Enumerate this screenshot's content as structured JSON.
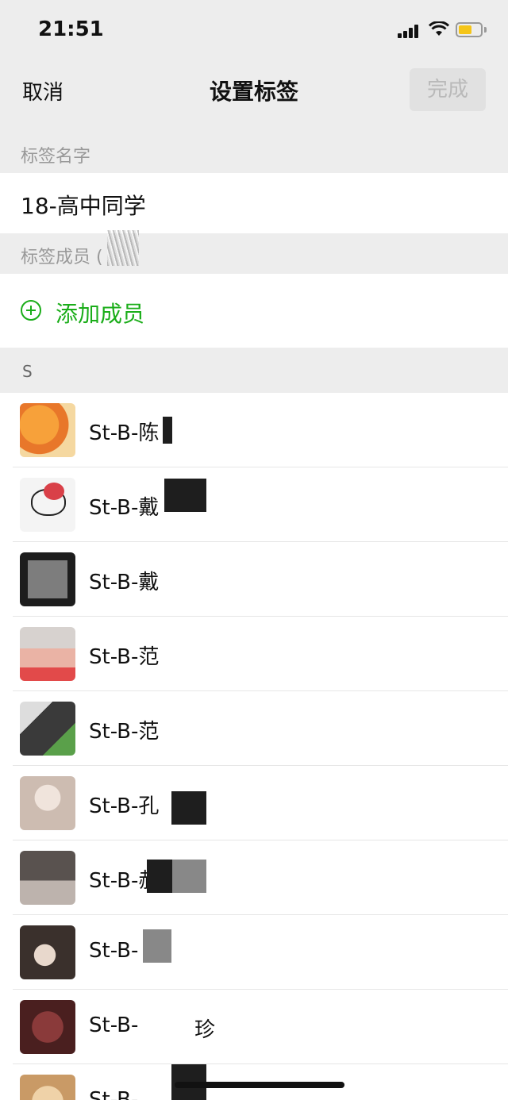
{
  "status": {
    "time": "21:51",
    "battery_level": 0.6
  },
  "nav": {
    "cancel_label": "取消",
    "title": "设置标签",
    "done_label": "完成"
  },
  "tag_name": {
    "section_label": "标签名字",
    "value": "18-高中同学"
  },
  "members_section": {
    "label": "标签成员 ("
  },
  "add_member": {
    "label": "添加成员"
  },
  "index": {
    "letter": "S"
  },
  "members": [
    {
      "name": "St-B-陈",
      "avatar_color": "#f08a2c"
    },
    {
      "name": "St-B-戴",
      "avatar_color": "#f2f2f2"
    },
    {
      "name": "St-B-戴",
      "avatar_color": "#2b2b2b"
    },
    {
      "name": "St-B-范",
      "avatar_color": "#e8b3a8"
    },
    {
      "name": "St-B-范",
      "avatar_color": "#4a4a4a"
    },
    {
      "name": "St-B-孔",
      "avatar_color": "#d8c9c0"
    },
    {
      "name": "St-B-郝",
      "avatar_color": "#6f6a68"
    },
    {
      "name": "St-B-",
      "avatar_color": "#3c3430"
    },
    {
      "name": "St-B-",
      "avatar_color": "#5a2525"
    },
    {
      "name": "St-B-",
      "avatar_color": "#d9b48a"
    }
  ],
  "member_suffix_8": "珍",
  "colors": {
    "accent_green": "#1aad19",
    "background": "#ededed",
    "done_disabled_text": "#b9b9b9"
  }
}
